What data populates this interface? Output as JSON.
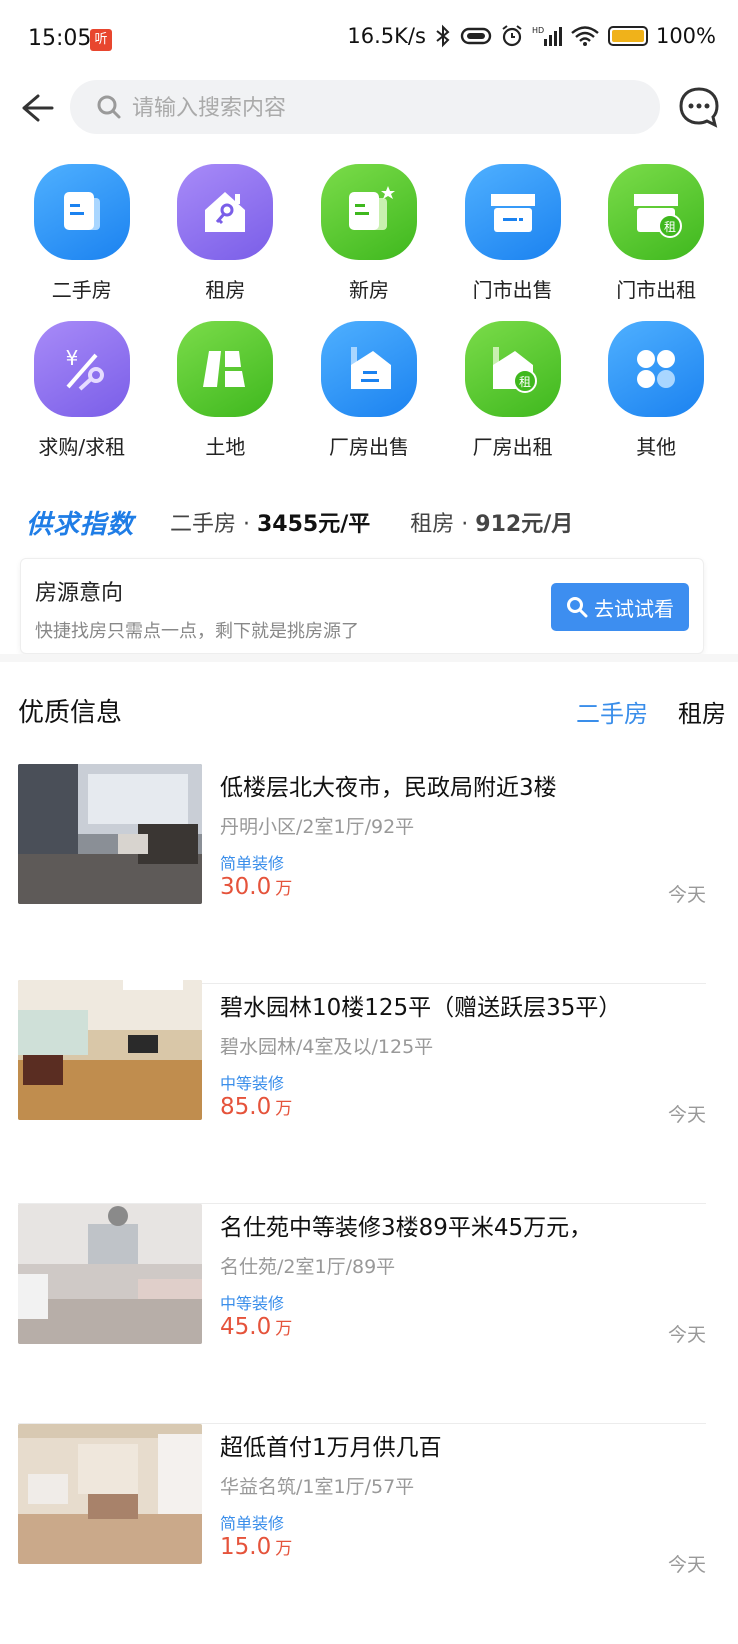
{
  "status_bar": {
    "time": "15:05",
    "app_badge": "听",
    "net_speed": "16.5K/s",
    "battery": "100%"
  },
  "search": {
    "placeholder": "请输入搜索内容"
  },
  "categories": [
    {
      "label": "二手房",
      "icon": "document-icon",
      "color": "#1b82f0"
    },
    {
      "label": "租房",
      "icon": "house-key-icon",
      "color": "#7a5ee8"
    },
    {
      "label": "新房",
      "icon": "document-star-icon",
      "color": "#3fb81e"
    },
    {
      "label": "门市出售",
      "icon": "storefront-icon",
      "color": "#1b82f0"
    },
    {
      "label": "门市出租",
      "icon": "storefront-rent-icon",
      "color": "#3fb81e"
    },
    {
      "label": "求购/求租",
      "icon": "yuan-key-icon",
      "color": "#7a5ee8"
    },
    {
      "label": "土地",
      "icon": "land-icon",
      "color": "#3fb81e"
    },
    {
      "label": "厂房出售",
      "icon": "factory-icon",
      "color": "#1b82f0"
    },
    {
      "label": "厂房出租",
      "icon": "factory-rent-icon",
      "color": "#3fb81e"
    },
    {
      "label": "其他",
      "icon": "grid-dots-icon",
      "color": "#1b82f0"
    }
  ],
  "index": {
    "logo": "供求指数",
    "second_hand_label": "二手房 · ",
    "second_hand_value": "3455元/平",
    "rent_label": "租房 · ",
    "rent_value": "912元/月"
  },
  "intent": {
    "title": "房源意向",
    "subtitle": "快捷找房只需点一点，剩下就是挑房源了",
    "button": "去试试看"
  },
  "section": {
    "title": "优质信息",
    "tab_active": "二手房",
    "tab_other": "租房"
  },
  "listings": [
    {
      "title": "低楼层北大夜市，民政局附近3楼",
      "sub": "丹明小区/2室1厅/92平",
      "tag": "简单装修",
      "price": "30.0",
      "unit": "万",
      "date": "今天"
    },
    {
      "title": "碧水园林10楼125平（赠送跃层35平）",
      "sub": "碧水园林/4室及以/125平",
      "tag": "中等装修",
      "price": "85.0",
      "unit": "万",
      "date": "今天"
    },
    {
      "title": "名仕苑中等装修3楼89平米45万元，",
      "sub": "名仕苑/2室1厅/89平",
      "tag": "中等装修",
      "price": "45.0",
      "unit": "万",
      "date": "今天"
    },
    {
      "title": "超低首付1万月供几百",
      "sub": "华益名筑/1室1厅/57平",
      "tag": "简单装修",
      "price": "15.0",
      "unit": "万",
      "date": "今天"
    }
  ]
}
